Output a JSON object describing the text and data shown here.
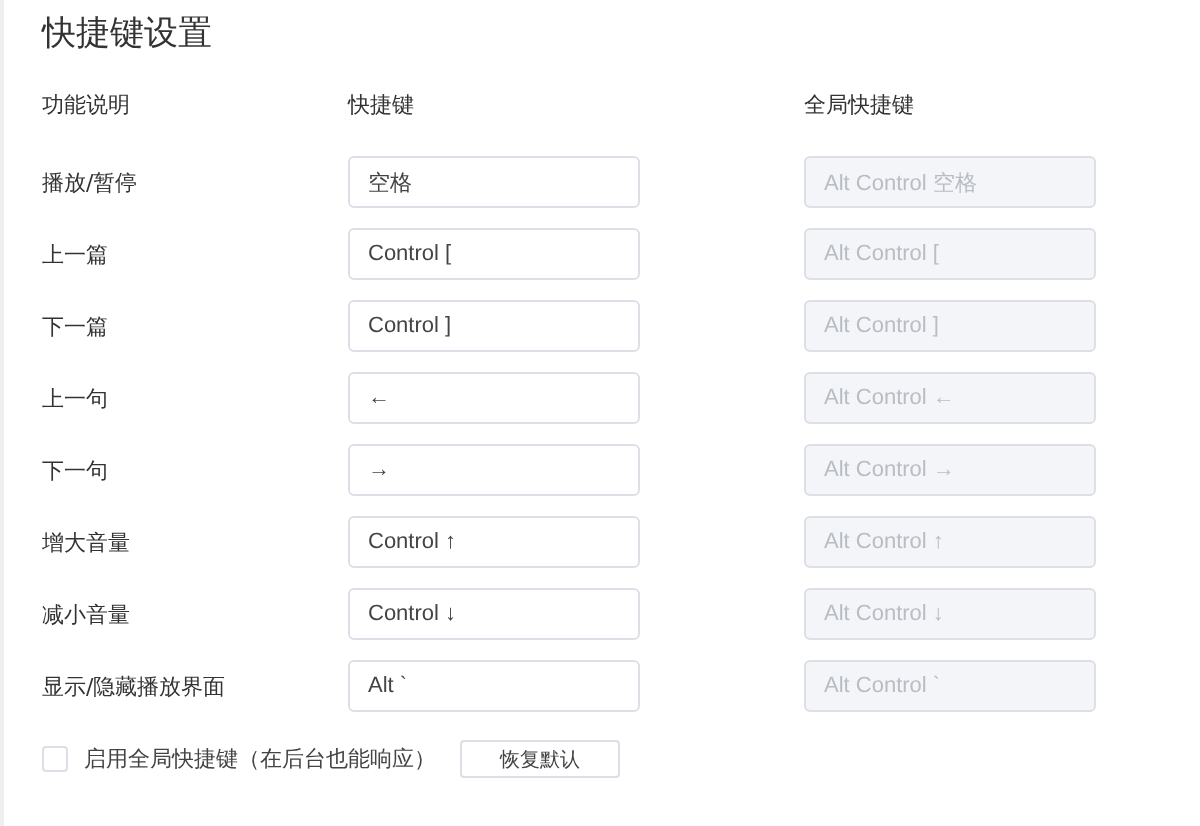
{
  "title": "快捷键设置",
  "columns": [
    "功能说明",
    "快捷键",
    "全局快捷键"
  ],
  "rows": [
    {
      "label": "播放/暂停",
      "shortcut": "空格",
      "global_shortcut": "Alt Control 空格",
      "global_disabled": true
    },
    {
      "label": "上一篇",
      "shortcut": "Control [",
      "global_shortcut": "Alt Control [",
      "global_disabled": true
    },
    {
      "label": "下一篇",
      "shortcut": "Control ]",
      "global_shortcut": "Alt Control ]",
      "global_disabled": true
    },
    {
      "label": "上一句",
      "shortcut": "←",
      "global_shortcut": "Alt Control ←",
      "global_disabled": true
    },
    {
      "label": "下一句",
      "shortcut": "→",
      "global_shortcut": "Alt Control →",
      "global_disabled": true
    },
    {
      "label": "增大音量",
      "shortcut": "Control ↑",
      "global_shortcut": "Alt Control ↑",
      "global_disabled": true
    },
    {
      "label": "减小音量",
      "shortcut": "Control ↓",
      "global_shortcut": "Alt Control ↓",
      "global_disabled": true
    },
    {
      "label": "显示/隐藏播放界面",
      "shortcut": "Alt `",
      "global_shortcut": "Alt Control `",
      "global_disabled": true
    }
  ],
  "enable_global": {
    "label": "启用全局快捷键（在后台也能响应）",
    "checked": false
  },
  "reset_button": "恢复默认"
}
